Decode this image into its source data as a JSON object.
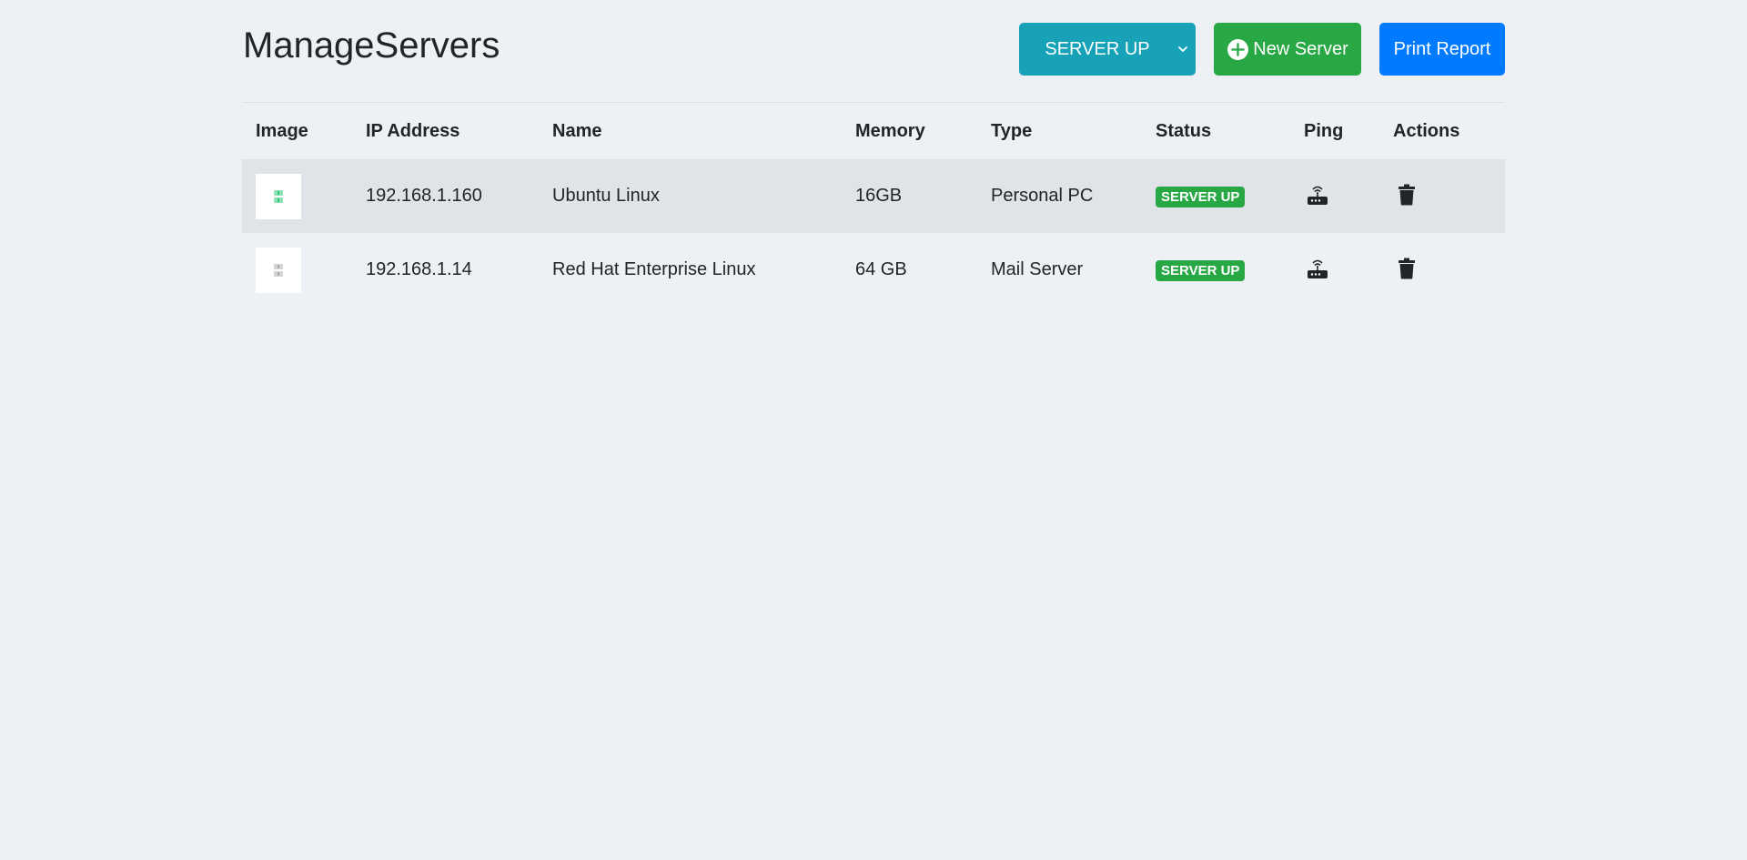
{
  "page": {
    "title": "ManageServers"
  },
  "toolbar": {
    "status_filter": {
      "selected": "SERVER UP"
    },
    "new_server_label": "New Server",
    "print_report_label": "Print Report"
  },
  "table": {
    "columns": [
      "Image",
      "IP Address",
      "Name",
      "Memory",
      "Type",
      "Status",
      "Ping",
      "Actions"
    ],
    "rows": [
      {
        "ip": "192.168.1.160",
        "name": "Ubuntu Linux",
        "memory": "16GB",
        "type": "Personal PC",
        "status": "SERVER UP",
        "image_icon": "server-green-icon",
        "ping_icon": "router-icon",
        "action_icon": "trash-icon"
      },
      {
        "ip": "192.168.1.14",
        "name": "Red Hat Enterprise Linux",
        "memory": "64 GB",
        "type": "Mail Server",
        "status": "SERVER UP",
        "image_icon": "server-gray-icon",
        "ping_icon": "router-icon",
        "action_icon": "trash-icon"
      }
    ]
  },
  "colors": {
    "background": "#edf0f5",
    "info": "#17a2b8",
    "success": "#28a745",
    "primary": "#007bff",
    "stripe": "#e0e3e8"
  }
}
